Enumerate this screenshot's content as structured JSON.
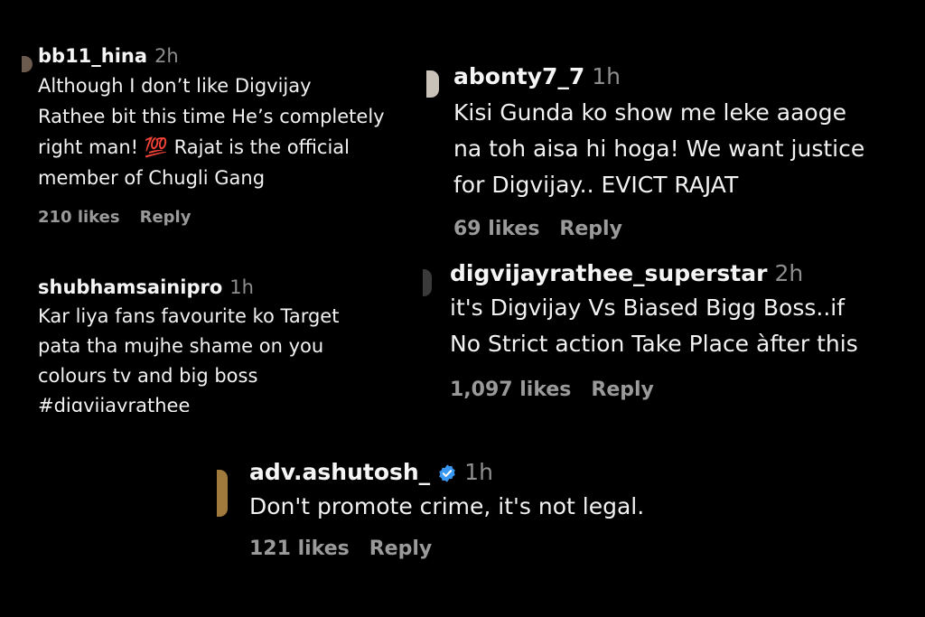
{
  "comments": [
    {
      "username": "bb11_hina",
      "time": "2h",
      "lines": [
        "Although I don’t like Digvijay",
        "Rathee bit this time He’s completely",
        "right man! 💯  Rajat is the official",
        "member of Chugli Gang"
      ],
      "likes": "210 likes",
      "reply": "Reply"
    },
    {
      "username": "shubhamsainipro",
      "time": "1h",
      "lines": [
        "Kar liya fans favourite ko Target",
        "pata tha mujhe shame on you",
        "colours tv and big boss",
        "#digvijayrathee"
      ]
    },
    {
      "username": "abonty7_7",
      "time": "1h",
      "lines": [
        "Kisi Gunda ko show me leke aaoge",
        "na toh aisa hi hoga! We want justice",
        "for Digvijay.. EVICT RAJAT"
      ],
      "likes": "69 likes",
      "reply": "Reply"
    },
    {
      "username": "digvijayrathee_superstar",
      "time": "2h",
      "lines": [
        "it's Digvijay Vs Biased Bigg Boss..if",
        "No Strict action Take Place àfter this"
      ],
      "likes": "1,097 likes",
      "reply": "Reply"
    },
    {
      "username": "adv.ashutosh_",
      "verified_icon": "verified-badge-icon",
      "verified_color": "#3897f0",
      "time": "1h",
      "lines": [
        "Don't promote crime, it's not legal."
      ],
      "likes": "121 likes",
      "reply": "Reply"
    }
  ]
}
